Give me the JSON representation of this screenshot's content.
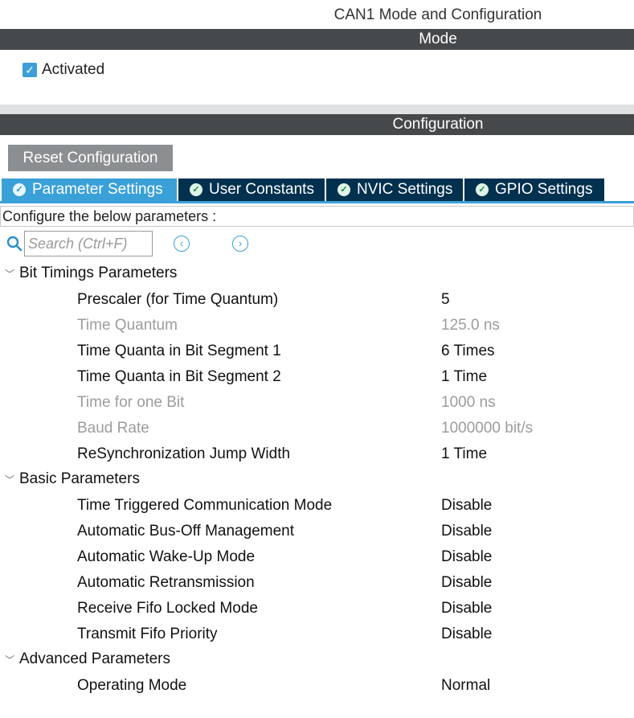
{
  "header": {
    "title": "CAN1 Mode and Configuration"
  },
  "mode": {
    "section_label": "Mode",
    "activated_label": "Activated",
    "activated_checked": true
  },
  "configuration": {
    "section_label": "Configuration",
    "reset_button": "Reset Configuration",
    "tabs": [
      {
        "label": "Parameter Settings",
        "active": true
      },
      {
        "label": "User Constants",
        "active": false
      },
      {
        "label": "NVIC Settings",
        "active": false
      },
      {
        "label": "GPIO Settings",
        "active": false
      }
    ],
    "instruction": "Configure the below parameters :",
    "search": {
      "placeholder": "Search (Ctrl+F)"
    }
  },
  "groups": [
    {
      "name": "Bit Timings Parameters",
      "params": [
        {
          "label": "Prescaler (for Time Quantum)",
          "value": "5",
          "enabled": true
        },
        {
          "label": "Time Quantum",
          "value": "125.0 ns",
          "enabled": false
        },
        {
          "label": "Time Quanta in Bit Segment 1",
          "value": "6 Times",
          "enabled": true
        },
        {
          "label": "Time Quanta in Bit Segment 2",
          "value": "1 Time",
          "enabled": true
        },
        {
          "label": "Time for one Bit",
          "value": "1000 ns",
          "enabled": false
        },
        {
          "label": "Baud Rate",
          "value": "1000000 bit/s",
          "enabled": false
        },
        {
          "label": "ReSynchronization Jump Width",
          "value": "1 Time",
          "enabled": true
        }
      ]
    },
    {
      "name": "Basic Parameters",
      "params": [
        {
          "label": "Time Triggered Communication Mode",
          "value": "Disable",
          "enabled": true
        },
        {
          "label": "Automatic Bus-Off Management",
          "value": "Disable",
          "enabled": true
        },
        {
          "label": "Automatic Wake-Up Mode",
          "value": "Disable",
          "enabled": true
        },
        {
          "label": "Automatic Retransmission",
          "value": "Disable",
          "enabled": true
        },
        {
          "label": "Receive Fifo Locked Mode",
          "value": "Disable",
          "enabled": true
        },
        {
          "label": "Transmit Fifo Priority",
          "value": "Disable",
          "enabled": true
        }
      ]
    },
    {
      "name": "Advanced Parameters",
      "params": [
        {
          "label": "Operating Mode",
          "value": "Normal",
          "enabled": true
        }
      ]
    }
  ],
  "colors": {
    "section_bar": "#45494c",
    "active_tab": "#3aa0d8",
    "inactive_tab": "#02314f",
    "checkbox": "#3d9fd9",
    "disabled_text": "#9c9c9c"
  },
  "icons": {
    "tab_status": "check-circle-icon",
    "search": "search-icon",
    "prev": "chevron-left-circle-icon",
    "next": "chevron-right-circle-icon",
    "group_toggle": "chevron-down-icon"
  }
}
